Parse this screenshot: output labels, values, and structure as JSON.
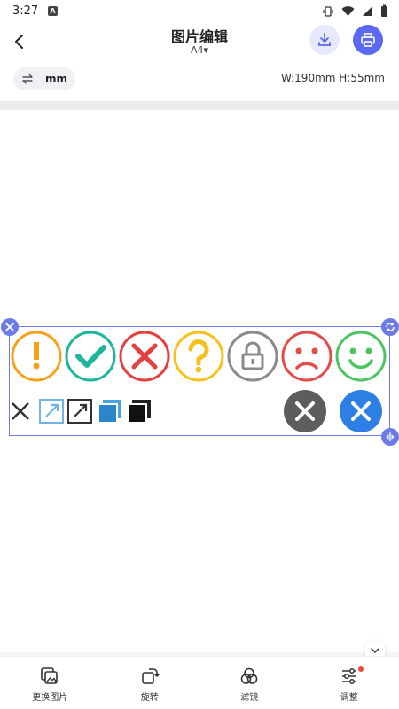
{
  "status_bar": {
    "time": "3:27",
    "notification_icon": "A"
  },
  "header": {
    "title": "图片编辑",
    "paper_size": "A4",
    "paper_caret": "▾"
  },
  "toolbar": {
    "unit_label": "mm",
    "dimensions": "W:190mm H:55mm"
  },
  "canvas": {
    "emoji_row": [
      {
        "icon": "exclamation-icon",
        "color": "#f4a21d"
      },
      {
        "icon": "check-icon",
        "color": "#1fb59a"
      },
      {
        "icon": "cross-icon",
        "color": "#e54040"
      },
      {
        "icon": "question-icon",
        "color": "#f3c21c"
      },
      {
        "icon": "lock-icon",
        "color": "#8a8a8a"
      },
      {
        "icon": "sad-face-icon",
        "color": "#e44b4b"
      },
      {
        "icon": "smile-face-icon",
        "color": "#4cc462"
      }
    ],
    "symbol_row": [
      "x-mark-icon",
      "expand-light-icon",
      "expand-dark-icon",
      "layers-blue-icon",
      "layers-black-icon",
      "close-grey-circle-icon",
      "close-blue-circle-icon"
    ]
  },
  "bottom_tabs": [
    {
      "label": "更换图片",
      "icon": "replace-image-icon"
    },
    {
      "label": "旋转",
      "icon": "rotate-icon"
    },
    {
      "label": "滤镜",
      "icon": "filter-icon"
    },
    {
      "label": "调整",
      "icon": "adjust-icon",
      "badge": true
    }
  ],
  "colors": {
    "accent": "#5b68f0",
    "selection": "#6c7be8"
  }
}
